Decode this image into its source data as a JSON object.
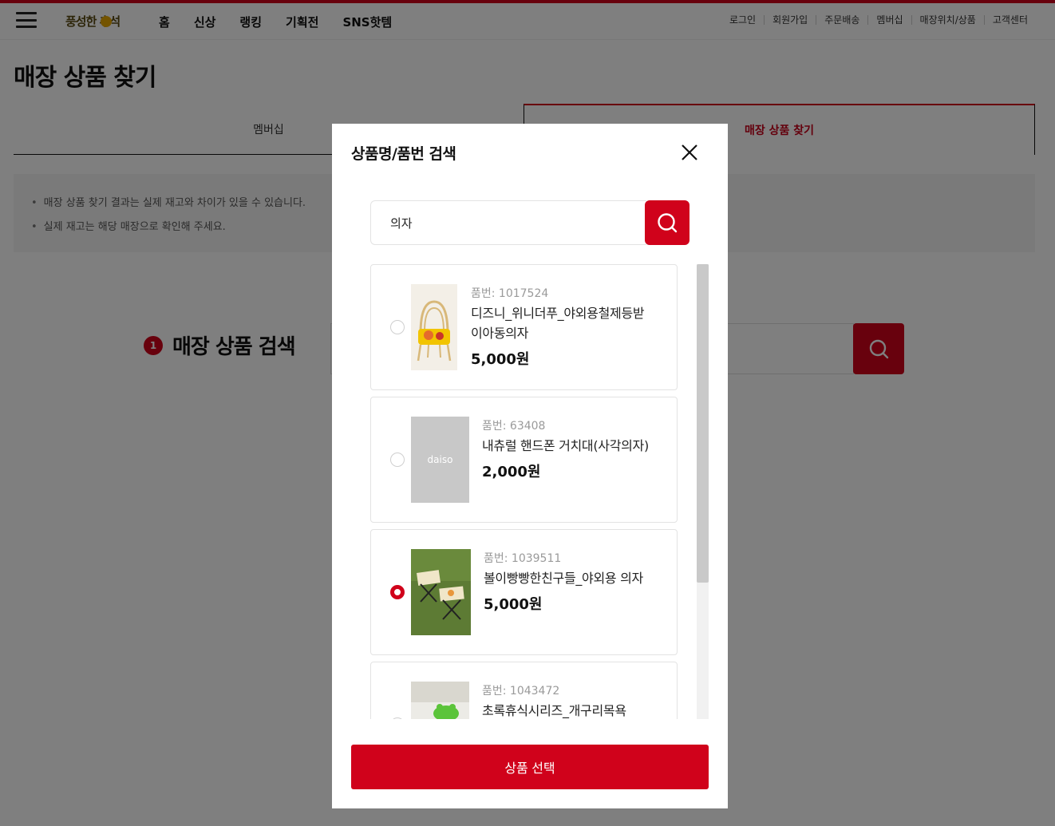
{
  "header": {
    "logo": "풍성한 추석",
    "menu": [
      "홈",
      "신상",
      "랭킹",
      "기획전",
      "SNS핫템"
    ],
    "util": [
      "로그인",
      "회원가입",
      "주문배송",
      "멤버십",
      "매장위치/상품",
      "고객센터"
    ]
  },
  "page": {
    "title": "매장 상품 찾기",
    "tabs": [
      "멤버십",
      "매장 상품 찾기"
    ],
    "notices": [
      "매장 상품 찾기 결과는 실제 재고와 차이가 있을 수 있습니다.",
      "실제 재고는 해당 매장으로 확인해 주세요."
    ],
    "step_number": "1",
    "step_label": "매장 상품 검색"
  },
  "modal": {
    "title": "상품명/품번 검색",
    "search_value": "의자",
    "select_button": "상품 선택",
    "items": [
      {
        "code": "품번: 1017524",
        "name": "디즈니_위니더푸_야외용철제등받이아동의자",
        "price": "5,000원",
        "selected": false,
        "thumb": "chair-photo"
      },
      {
        "code": "품번: 63408",
        "name": "내츄럴 핸드폰 거치대(사각의자)",
        "price": "2,000원",
        "selected": false,
        "thumb": "daiso-placeholder",
        "thumb_text": "daiso"
      },
      {
        "code": "품번: 1039511",
        "name": "볼이빵빵한친구들_야외용 의자",
        "price": "5,000원",
        "selected": true,
        "thumb": "stool-photo"
      },
      {
        "code": "품번: 1043472",
        "name": "초록휴식시리즈_개구리목욕",
        "price": "",
        "selected": false,
        "thumb": "frog-photo"
      }
    ]
  },
  "colors": {
    "accent": "#d0021b",
    "dim": "rgba(0,0,0,0.5)"
  }
}
